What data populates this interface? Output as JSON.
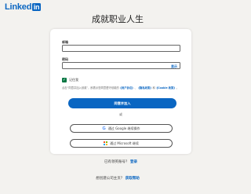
{
  "header": {
    "logo_word": "Linked",
    "logo_box": "in"
  },
  "headline": "成就职业人生",
  "form": {
    "email_label": "邮箱",
    "email_value": "",
    "password_label": "密码",
    "password_value": "",
    "show_password": "显示",
    "remember_checked": true,
    "remember_label": "记住我",
    "legal_prefix": "点击“同意并加入领英”，即表示您同意遵守领英的",
    "legal_user_agreement": "《用户协议》",
    "legal_sep1": "、",
    "legal_privacy": "《隐私政策》",
    "legal_sep2": "和",
    "legal_cookie": "《Cookie 政策》",
    "legal_suffix": "。",
    "primary_button": "同意并加入",
    "or_text": "或",
    "google_button": "通过 Google 继续操作",
    "microsoft_button": "通过 Microsoft 继续",
    "signin_prompt": "已有领英账号？",
    "signin_link": "登录"
  },
  "footer": {
    "company_prompt": "想创建公司主页？",
    "company_link": "获取帮助"
  },
  "colors": {
    "brand": "#0a66c2",
    "background": "#f3f2ef",
    "checkbox": "#057642"
  },
  "icons": {
    "google": "google-icon",
    "microsoft": "microsoft-icon",
    "checkmark": "checkmark-icon"
  }
}
